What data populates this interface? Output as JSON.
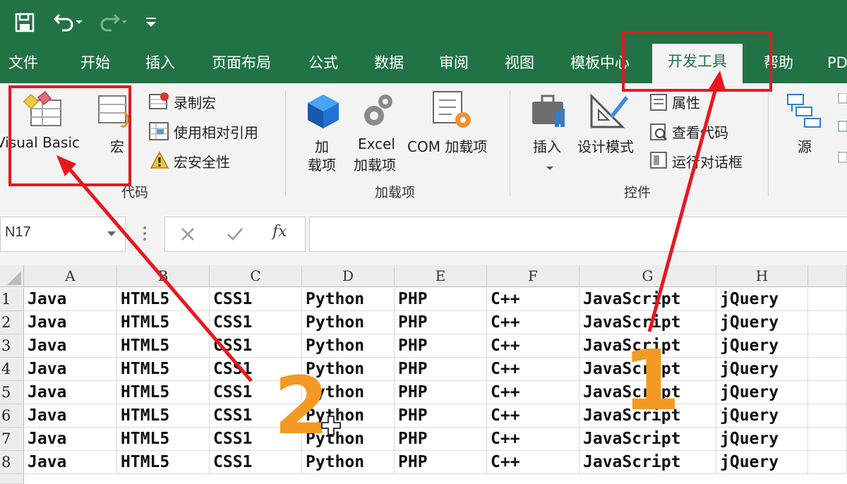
{
  "quick_access": {
    "save_icon": "save-icon",
    "undo_icon": "undo-icon",
    "redo_icon": "redo-icon",
    "customize_icon": "customize-qa-icon"
  },
  "tabs": [
    "文件",
    "开始",
    "插入",
    "页面布局",
    "公式",
    "数据",
    "审阅",
    "视图",
    "模板中心",
    "开发工具",
    "帮助",
    "PD"
  ],
  "active_tab": "开发工具",
  "ribbon": {
    "code": {
      "visual_basic": "Visual Basic",
      "macro": "宏",
      "record_macro": "录制宏",
      "relative_ref": "使用相对引用",
      "macro_security": "宏安全性",
      "group_label": "代码"
    },
    "addins": {
      "addin_line1": "加",
      "addin_line2": "载项",
      "excel_line1": "Excel",
      "excel_line2": "加载项",
      "com": "COM 加载项",
      "group_label": "加载项"
    },
    "controls": {
      "insert": "插入",
      "design_mode": "设计模式",
      "properties": "属性",
      "view_code": "查看代码",
      "run_dialog": "运行对话框",
      "group_label": "控件"
    },
    "xml": {
      "source": "源"
    }
  },
  "formula_bar": {
    "name_box": "N17",
    "fx": "fx",
    "cancel_icon": "cancel-icon",
    "enter_icon": "enter-icon"
  },
  "columns": [
    "A",
    "B",
    "C",
    "D",
    "E",
    "F",
    "G",
    "H"
  ],
  "rows": [
    {
      "num": "1",
      "cells": [
        "Java",
        "HTML5",
        "CSS1",
        "Python",
        "PHP",
        "C++",
        "JavaScript",
        "jQuery"
      ]
    },
    {
      "num": "2",
      "cells": [
        "Java",
        "HTML5",
        "CSS1",
        "Python",
        "PHP",
        "C++",
        "JavaScript",
        "jQuery"
      ]
    },
    {
      "num": "3",
      "cells": [
        "Java",
        "HTML5",
        "CSS1",
        "Python",
        "PHP",
        "C++",
        "JavaScript",
        "jQuery"
      ]
    },
    {
      "num": "4",
      "cells": [
        "Java",
        "HTML5",
        "CSS1",
        "Python",
        "PHP",
        "C++",
        "JavaScript",
        "jQuery"
      ]
    },
    {
      "num": "5",
      "cells": [
        "Java",
        "HTML5",
        "CSS1",
        "Python",
        "PHP",
        "C++",
        "JavaScript",
        "jQuery"
      ]
    },
    {
      "num": "6",
      "cells": [
        "Java",
        "HTML5",
        "CSS1",
        "Python",
        "PHP",
        "C++",
        "JavaScript",
        "jQuery"
      ]
    },
    {
      "num": "7",
      "cells": [
        "Java",
        "HTML5",
        "CSS1",
        "Python",
        "PHP",
        "C++",
        "JavaScript",
        "jQuery"
      ]
    },
    {
      "num": "8",
      "cells": [
        "Java",
        "HTML5",
        "CSS1",
        "Python",
        "PHP",
        "C++",
        "JavaScript",
        "jQuery"
      ]
    }
  ],
  "annotations": {
    "step1": "1",
    "step2": "2"
  },
  "colors": {
    "accent": "#217346",
    "annotation_red": "#e8171f",
    "annotation_orange": "#f49a24"
  }
}
